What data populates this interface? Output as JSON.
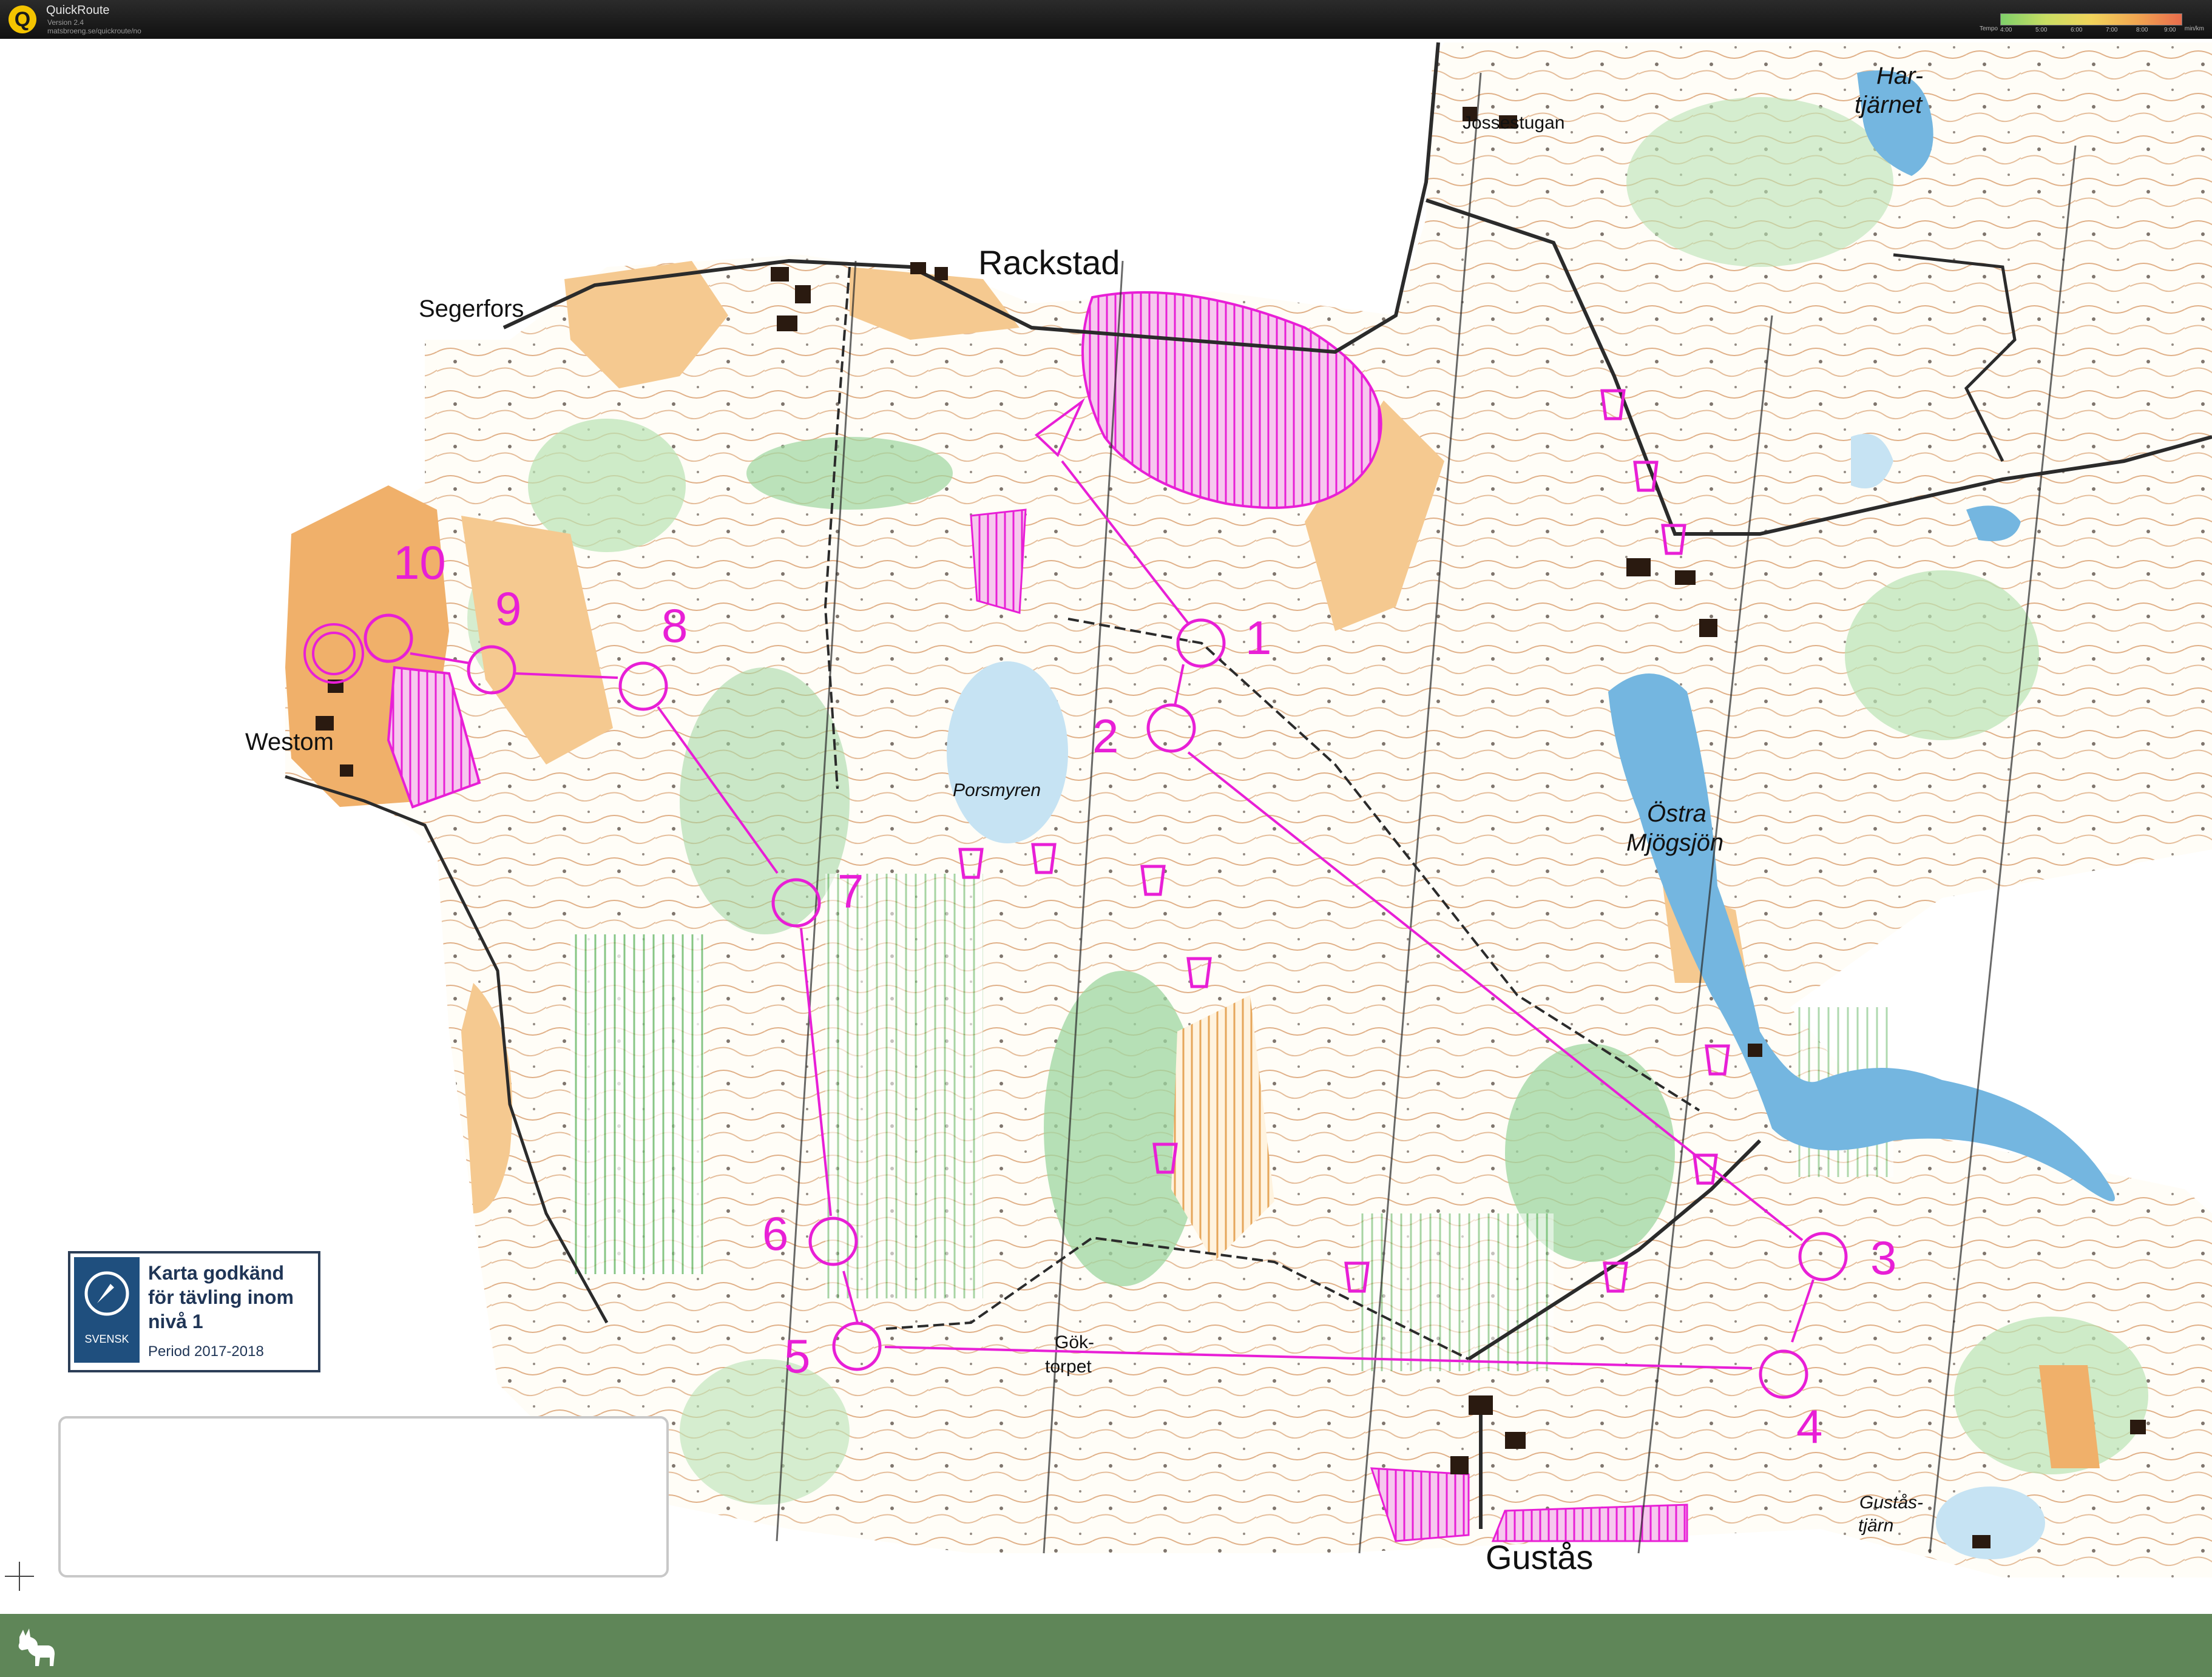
{
  "app": {
    "title": "QuickRoute",
    "version": "Version 2.4",
    "url": "matsbroeng.se/quickroute/no"
  },
  "tempo_legend": {
    "label": "Tempo",
    "ticks": [
      "4:00",
      "5:00",
      "6:00",
      "7:00",
      "8:00",
      "9:00"
    ],
    "unit": "min/km"
  },
  "map": {
    "places": {
      "rackstad": "Rackstad",
      "segerfors": "Segerfors",
      "westom": "Westom",
      "jossestugan": "Jossestugan",
      "hartjarnet_1": "Har-",
      "hartjarnet_2": "tjärnet",
      "porsmyren": "Porsmyren",
      "ostra_1": "Östra",
      "ostra_2": "Mjögsjön",
      "goktorpet_1": "Gök-",
      "goktorpet_2": "torpet",
      "gustas": "Gustås",
      "gustastjarn_1": "Gustås-",
      "gustastjarn_2": "tjärn"
    },
    "controls": [
      "1",
      "2",
      "3",
      "4",
      "5",
      "6",
      "7",
      "8",
      "9",
      "10"
    ],
    "colors": {
      "course": "#e81fd6",
      "open_land": "#f5c990",
      "forest_green": "#9ed6a0",
      "water": "#74b6e0",
      "contour": "#c6712d",
      "building": "#2a1a10"
    }
  },
  "approval_badge": {
    "logo_text": "SVENSK",
    "line1": "Karta godkänd",
    "line2": "för tävling inom",
    "line3": "nivå 1",
    "period": "Period 2017-2018"
  }
}
